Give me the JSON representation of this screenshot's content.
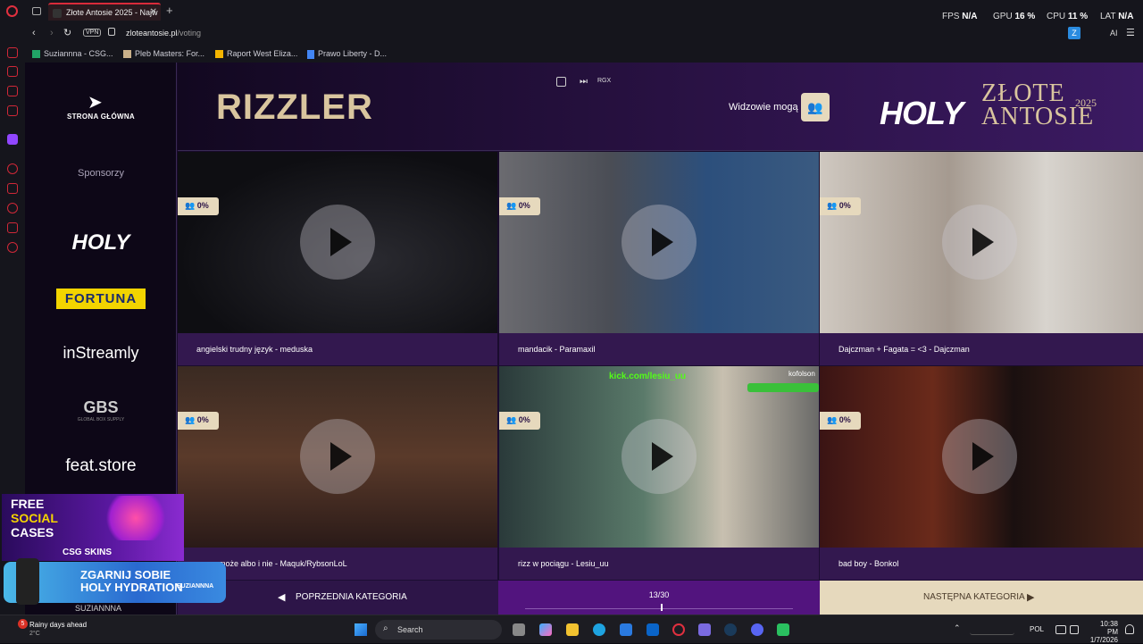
{
  "browser": {
    "tab_title": "Złote Antosie 2025 - Najw",
    "new_tab": "+",
    "url_domain": "zloteantosie.pl",
    "url_path": "/voting",
    "vpn_label": "VPN",
    "bookmarks": [
      "Suziannna - CSG...",
      "Pleb Masters: For...",
      "Raport West Eliza...",
      "Prawo Liberty - D..."
    ],
    "stats": {
      "fps_label": "FPS",
      "fps_value": "N/A",
      "gpu_label": "GPU",
      "gpu_value": "16 %",
      "cpu_label": "CPU",
      "cpu_value": "11 %",
      "lat_label": "LAT",
      "lat_value": "N/A"
    },
    "ai_label": "AI",
    "ext_letter": "Z"
  },
  "page": {
    "home_label": "STRONA GŁÓWNA",
    "sponsors_label": "Sponsorzy",
    "sponsors": [
      "HOLY",
      "FORTUNA",
      "inStreamly",
      "GBS",
      "feat.store"
    ],
    "gbs_sub": "GLOBAL BOX SUPPLY",
    "category_title": "RIZZLER",
    "viewers_label": "Widzowie mogą",
    "tool_rgx": "RGX",
    "logo_holy": "HOLY",
    "logo_zlote_1": "ZŁOTE",
    "logo_zlote_2": "ANTOSIE",
    "logo_year": "2025"
  },
  "videos": [
    {
      "percent": "0%",
      "caption": "angielski trudny język - meduska"
    },
    {
      "percent": "0%",
      "caption": "mandacik - Paramaxil"
    },
    {
      "percent": "0%",
      "caption": "Dajczman + Fagata = <3 - Dajczman"
    },
    {
      "percent": "0%",
      "caption": "...a pomoże albo i nie - Maquk/RybsonLoL"
    },
    {
      "percent": "0%",
      "caption": "rizz w pociągu - Lesiu_uu"
    },
    {
      "percent": "0%",
      "caption": "bad boy - Bonkol"
    }
  ],
  "thumb_overlays": {
    "kick": "kick.com/lesiu_uu",
    "kofo": "kofolson"
  },
  "nav": {
    "prev": "POPRZEDNIA KATEGORIA",
    "counter": "13/30",
    "next": "NASTĘPNA KATEGORIA"
  },
  "ad": {
    "line1": "FREE",
    "line2": "SOCIAL",
    "line3": "CASES",
    "brand": "CSG SKINS",
    "promo1": "ZGARNIJ SOBIE",
    "promo2": "HOLY HYDRATION",
    "streamer": "SUZIANNNA"
  },
  "taskbar": {
    "weather_title": "Rainy days ahead",
    "weather_temp": "2°C",
    "search": "Search",
    "lang": "POL",
    "time": "10:38 PM",
    "date": "1/7/2026",
    "notif_count": "5"
  }
}
